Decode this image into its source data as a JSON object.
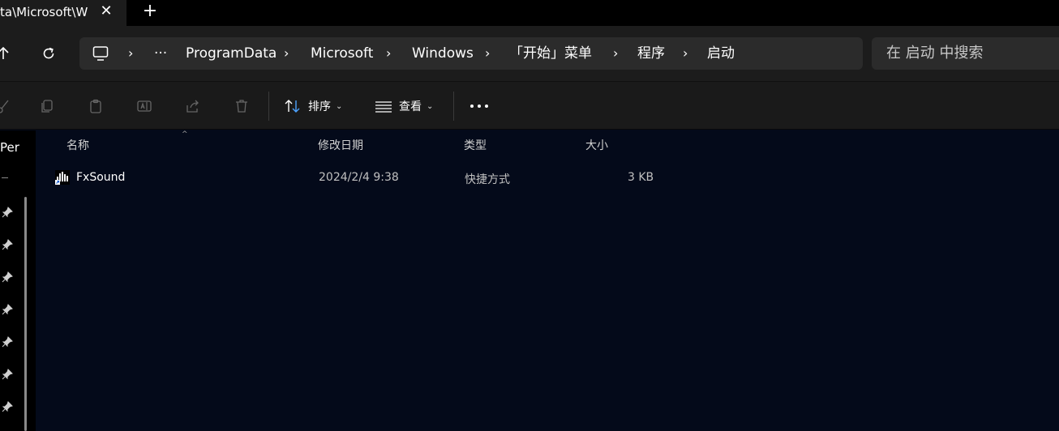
{
  "tab": {
    "title": "ta\\Microsoft\\Wi",
    "close_glyph": "✕",
    "new_glyph": "+"
  },
  "addressbar": {
    "ellipsis": "···",
    "separator": "›",
    "crumbs": [
      "ProgramData",
      "Microsoft",
      "Windows",
      "「开始」菜单",
      "程序",
      "启动"
    ]
  },
  "search": {
    "placeholder": "在 启动 中搜索"
  },
  "toolbar": {
    "sort_label": "排序",
    "view_label": "查看",
    "chevron": "⌄"
  },
  "navpane": {
    "partial_label": "Per"
  },
  "columns": {
    "name": "名称",
    "date": "修改日期",
    "type": "类型",
    "size": "大小",
    "sort_caret": "^"
  },
  "files": [
    {
      "name": "FxSound",
      "date": "2024/2/4 9:38",
      "type": "快捷方式",
      "size": "3 KB"
    }
  ],
  "colors": {
    "background": "#040a1a",
    "chrome": "#1c1c1c",
    "field": "#2b2b2b",
    "muted_text": "#c0c0c0"
  }
}
